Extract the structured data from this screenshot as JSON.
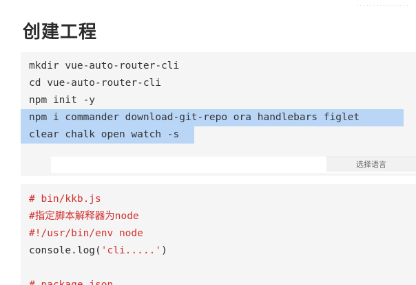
{
  "header": {
    "title": "创建工程",
    "watermark": "................"
  },
  "code_block_1": {
    "lines": [
      "mkdir vue-auto-router-cli",
      "cd vue-auto-router-cli",
      "npm init -y",
      "npm i commander download-git-repo ora handlebars figlet",
      "clear chalk open watch -s"
    ],
    "language_select_label": "选择语言"
  },
  "code_block_2": {
    "comment_1": "# bin/kkb.js",
    "comment_2": "#指定脚本解释器为node",
    "comment_3": "#!/usr/bin/env node",
    "console_prefix": "console.log(",
    "console_string": "'cli.....'",
    "console_suffix": ")",
    "comment_4": "# package.json"
  },
  "colors": {
    "selection": "#b9d6f7",
    "comment": "#d1302e",
    "code_bg": "#f5f5f5"
  }
}
